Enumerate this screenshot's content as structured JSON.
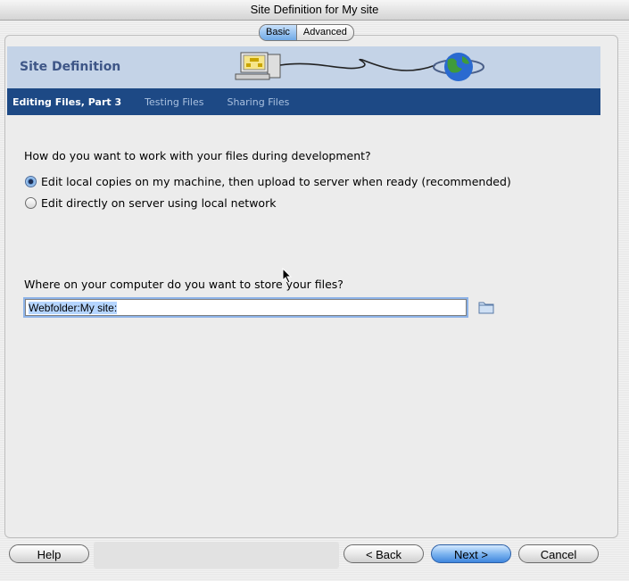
{
  "window": {
    "title": "Site Definition for My site"
  },
  "tabs": {
    "basic": "Basic",
    "advanced": "Advanced"
  },
  "header": {
    "title": "Site Definition"
  },
  "steps": {
    "current": "Editing Files, Part 3",
    "next1": "Testing Files",
    "next2": "Sharing Files"
  },
  "question1": "How do you want to work with your files during development?",
  "options": {
    "local": "Edit local copies on my machine, then upload to server when ready (recommended)",
    "server": "Edit directly on server using local network"
  },
  "selected_option": "local",
  "question2": "Where on your computer do you want to store your files?",
  "folder_field": {
    "value": "Webfolder:My site:"
  },
  "buttons": {
    "help": "Help",
    "back": "< Back",
    "next": "Next >",
    "cancel": "Cancel"
  },
  "colors": {
    "stepbar": "#1d4985",
    "header": "#c4d3e7",
    "header_text": "#3e5687"
  },
  "icons": [
    "computer-icon",
    "globe-icon",
    "folder-icon",
    "radio-selected-icon",
    "mouse-pointer-icon"
  ]
}
